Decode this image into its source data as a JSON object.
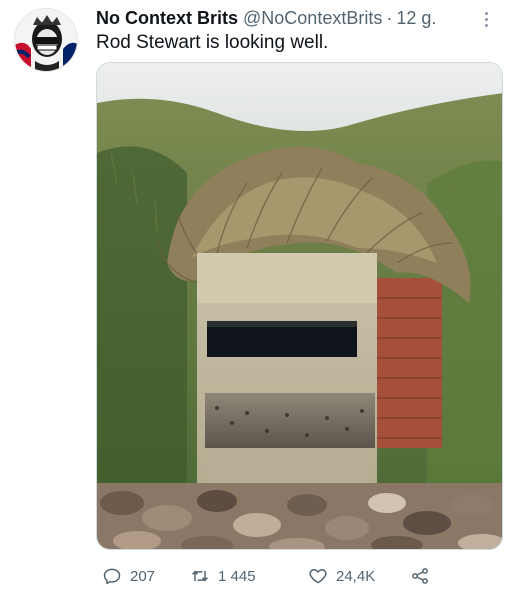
{
  "tweet": {
    "author": {
      "display_name": "No Context Brits",
      "handle": "@NoContextBrits",
      "separator": "·",
      "time": "12 g.",
      "avatar_icon": "avatar-queen-punk"
    },
    "text": "Rod Stewart is looking well.",
    "media": {
      "icon": "photo-pillbox-with-grass-hair"
    },
    "stats": {
      "replies": "207",
      "retweets": "1 445",
      "likes": "24,4K"
    },
    "icons": {
      "reply": "reply-icon",
      "retweet": "retweet-icon",
      "like": "heart-icon",
      "share": "share-icon",
      "more": "more-icon"
    },
    "colors": {
      "text_primary": "#0f1419",
      "text_secondary": "#536471",
      "border": "#cfd9de"
    }
  }
}
